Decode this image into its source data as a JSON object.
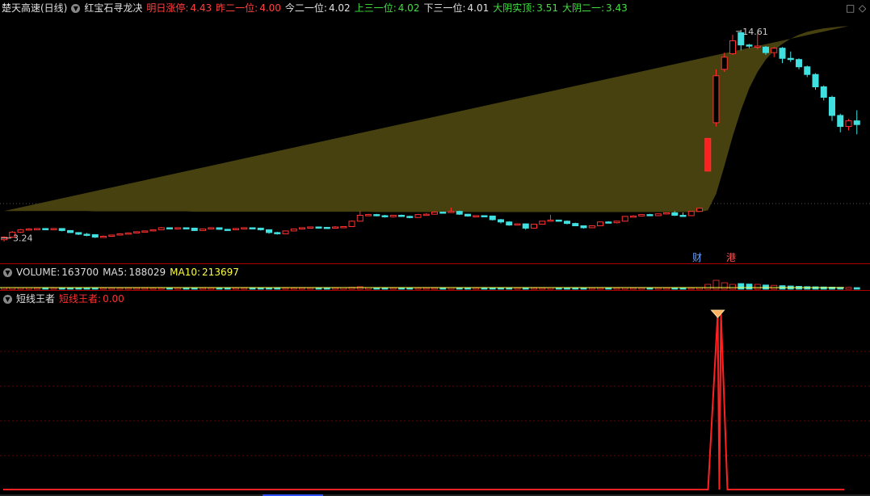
{
  "main": {
    "stock_name": "楚天高速(日线)",
    "formula_name": "红宝石寻龙决",
    "indicators": [
      {
        "label": "明日涨停:",
        "value": "4.43",
        "color": "#ff4040"
      },
      {
        "label": "昨二一位:",
        "value": "4.00",
        "color": "#ff4040"
      },
      {
        "label": "今二一位:",
        "value": "4.02",
        "color": "#e0e0e0"
      },
      {
        "label": "上三一位:",
        "value": "4.02",
        "color": "#40e040"
      },
      {
        "label": "下三一位:",
        "value": "4.01",
        "color": "#e0e0e0"
      },
      {
        "label": "大阴实顶:",
        "value": "3.51",
        "color": "#40e040"
      },
      {
        "label": "大阴二一:",
        "value": "3.43",
        "color": "#40e040"
      }
    ],
    "high_label": "14.61",
    "low_label": "3.24",
    "marker_cai": "财",
    "marker_gang": "港"
  },
  "volume": {
    "label": "VOLUME:",
    "value": "163700",
    "ma5_label": "MA5:",
    "ma5_value": "188029",
    "ma10_label": "MA10:",
    "ma10_value": "213697"
  },
  "indicator_panel": {
    "name": "短线王者",
    "line_label": "短线王者:",
    "line_value": "0.00"
  },
  "window": {
    "restore_icon": "□",
    "diamond_icon": "◇"
  },
  "chart_data": [
    {
      "type": "candlestick",
      "title": "红宝石寻龙决",
      "candles": [
        [
          3.24,
          3.3,
          3.2,
          3.32
        ],
        [
          3.3,
          3.42,
          3.28,
          3.45
        ],
        [
          3.42,
          3.48,
          3.4,
          3.5
        ],
        [
          3.48,
          3.5,
          3.46,
          3.52
        ],
        [
          3.5,
          3.51,
          3.49,
          3.52
        ],
        [
          3.51,
          3.5,
          3.49,
          3.52
        ],
        [
          3.5,
          3.51,
          3.49,
          3.52
        ],
        [
          3.51,
          3.46,
          3.44,
          3.52
        ],
        [
          3.46,
          3.41,
          3.4,
          3.47
        ],
        [
          3.41,
          3.37,
          3.35,
          3.42
        ],
        [
          3.37,
          3.36,
          3.32,
          3.4
        ],
        [
          3.36,
          3.3,
          3.28,
          3.37
        ],
        [
          3.3,
          3.32,
          3.29,
          3.34
        ],
        [
          3.32,
          3.35,
          3.31,
          3.36
        ],
        [
          3.35,
          3.38,
          3.34,
          3.39
        ],
        [
          3.38,
          3.4,
          3.37,
          3.41
        ],
        [
          3.4,
          3.43,
          3.39,
          3.44
        ],
        [
          3.43,
          3.45,
          3.42,
          3.46
        ],
        [
          3.45,
          3.48,
          3.44,
          3.49
        ],
        [
          3.48,
          3.53,
          3.47,
          3.55
        ],
        [
          3.53,
          3.5,
          3.49,
          3.54
        ],
        [
          3.5,
          3.53,
          3.49,
          3.54
        ],
        [
          3.53,
          3.52,
          3.51,
          3.54
        ],
        [
          3.52,
          3.46,
          3.45,
          3.53
        ],
        [
          3.46,
          3.5,
          3.45,
          3.51
        ],
        [
          3.5,
          3.53,
          3.49,
          3.54
        ],
        [
          3.53,
          3.49,
          3.48,
          3.54
        ],
        [
          3.49,
          3.48,
          3.47,
          3.5
        ],
        [
          3.48,
          3.51,
          3.47,
          3.52
        ],
        [
          3.51,
          3.53,
          3.5,
          3.54
        ],
        [
          3.53,
          3.52,
          3.51,
          3.54
        ],
        [
          3.52,
          3.48,
          3.46,
          3.53
        ],
        [
          3.48,
          3.41,
          3.38,
          3.49
        ],
        [
          3.41,
          3.38,
          3.36,
          3.43
        ],
        [
          3.38,
          3.45,
          3.37,
          3.46
        ],
        [
          3.45,
          3.5,
          3.44,
          3.51
        ],
        [
          3.5,
          3.53,
          3.49,
          3.54
        ],
        [
          3.53,
          3.55,
          3.52,
          3.56
        ],
        [
          3.55,
          3.54,
          3.53,
          3.56
        ],
        [
          3.54,
          3.52,
          3.51,
          3.55
        ],
        [
          3.52,
          3.55,
          3.51,
          3.57
        ],
        [
          3.55,
          3.56,
          3.54,
          3.57
        ],
        [
          3.56,
          3.7,
          3.55,
          3.72
        ],
        [
          3.7,
          3.86,
          3.69,
          3.98
        ],
        [
          3.86,
          3.88,
          3.84,
          3.9
        ],
        [
          3.88,
          3.85,
          3.83,
          3.9
        ],
        [
          3.85,
          3.82,
          3.8,
          3.87
        ],
        [
          3.82,
          3.86,
          3.8,
          3.87
        ],
        [
          3.86,
          3.83,
          3.82,
          3.88
        ],
        [
          3.83,
          3.8,
          3.78,
          3.85
        ],
        [
          3.8,
          3.88,
          3.79,
          3.9
        ],
        [
          3.88,
          3.89,
          3.87,
          3.92
        ],
        [
          3.89,
          3.95,
          3.88,
          3.97
        ],
        [
          3.95,
          3.94,
          3.93,
          3.96
        ],
        [
          3.94,
          3.97,
          3.93,
          4.08
        ],
        [
          3.97,
          3.89,
          3.87,
          3.99
        ],
        [
          3.89,
          3.84,
          3.82,
          3.9
        ],
        [
          3.84,
          3.85,
          3.83,
          3.86
        ],
        [
          3.85,
          3.84,
          3.83,
          3.86
        ],
        [
          3.84,
          3.74,
          3.72,
          3.85
        ],
        [
          3.74,
          3.68,
          3.64,
          3.76
        ],
        [
          3.68,
          3.6,
          3.58,
          3.7
        ],
        [
          3.6,
          3.63,
          3.59,
          3.64
        ],
        [
          3.63,
          3.52,
          3.48,
          3.64
        ],
        [
          3.52,
          3.62,
          3.51,
          3.63
        ],
        [
          3.62,
          3.7,
          3.61,
          3.71
        ],
        [
          3.7,
          3.73,
          3.69,
          3.87
        ],
        [
          3.73,
          3.7,
          3.69,
          3.74
        ],
        [
          3.7,
          3.64,
          3.62,
          3.72
        ],
        [
          3.64,
          3.58,
          3.57,
          3.66
        ],
        [
          3.58,
          3.53,
          3.51,
          3.59
        ],
        [
          3.53,
          3.58,
          3.52,
          3.59
        ],
        [
          3.58,
          3.68,
          3.57,
          3.69
        ],
        [
          3.68,
          3.66,
          3.65,
          3.7
        ],
        [
          3.66,
          3.7,
          3.64,
          3.71
        ],
        [
          3.7,
          3.83,
          3.69,
          3.84
        ],
        [
          3.83,
          3.84,
          3.82,
          3.86
        ],
        [
          3.84,
          3.88,
          3.83,
          3.89
        ],
        [
          3.88,
          3.85,
          3.84,
          3.9
        ],
        [
          3.85,
          3.9,
          3.84,
          3.91
        ],
        [
          3.9,
          3.93,
          3.89,
          3.94
        ],
        [
          3.93,
          3.86,
          3.84,
          3.98
        ],
        [
          3.86,
          3.85,
          3.84,
          3.94
        ],
        [
          3.85,
          3.97,
          3.84,
          3.98
        ],
        [
          3.97,
          4.06,
          3.96,
          4.07
        ],
        [
          5.3,
          6.7,
          5.3,
          6.7
        ],
        [
          7.5,
          10.5,
          7.3,
          11.0
        ],
        [
          11.0,
          12.0,
          10.8,
          12.4
        ],
        [
          12.3,
          13.5,
          12.2,
          14.1
        ],
        [
          14.3,
          13.1,
          12.6,
          14.61
        ],
        [
          13.1,
          13.0,
          12.8,
          13.2
        ],
        [
          13.0,
          13.0,
          12.7,
          14.4
        ],
        [
          12.9,
          12.4,
          12.2,
          13.0
        ],
        [
          12.4,
          12.8,
          12.0,
          12.9
        ],
        [
          12.8,
          11.9,
          11.5,
          12.9
        ],
        [
          11.9,
          11.8,
          11.6,
          12.5
        ],
        [
          11.8,
          11.2,
          11.0,
          11.9
        ],
        [
          11.2,
          10.6,
          10.4,
          11.3
        ],
        [
          10.6,
          9.7,
          9.5,
          10.7
        ],
        [
          9.7,
          9.0,
          8.8,
          9.8
        ],
        [
          9.0,
          7.9,
          7.6,
          9.1
        ],
        [
          7.9,
          7.3,
          7.0,
          8.0
        ],
        [
          7.3,
          7.6,
          7.1,
          7.7
        ],
        [
          7.6,
          7.4,
          6.9,
          8.2
        ]
      ],
      "high": 14.61,
      "low": 3.24,
      "channel_upper": [
        3.98,
        3.98,
        3.98,
        3.98,
        3.98,
        3.98,
        3.98,
        3.98,
        3.98,
        3.98,
        3.98,
        3.97,
        3.97,
        3.97,
        3.97,
        3.97,
        3.97,
        3.97,
        3.97,
        3.97,
        3.97,
        3.97,
        3.97,
        3.96,
        3.96,
        3.96,
        3.96,
        3.96,
        3.96,
        3.96,
        3.96,
        3.96,
        3.96,
        3.96,
        3.96,
        3.96,
        3.96,
        3.96,
        3.96,
        3.96,
        3.96,
        3.96,
        3.96,
        3.96,
        3.96,
        3.95,
        3.95,
        3.95,
        3.95,
        3.95,
        3.95,
        3.95,
        3.95,
        3.95,
        3.95,
        3.95,
        3.95,
        3.95,
        3.95,
        3.95,
        3.95,
        3.95,
        3.95,
        3.95,
        3.95,
        3.95,
        3.95,
        3.95,
        3.95,
        3.95,
        3.95,
        3.95,
        3.95,
        3.95,
        3.95,
        3.95,
        3.95,
        3.95,
        3.95,
        3.95,
        3.95,
        3.95,
        3.95,
        3.95,
        3.95,
        4.0,
        4.5,
        5.5,
        6.8,
        8.2,
        9.6,
        10.8,
        11.8,
        12.6,
        13.2,
        13.7,
        14.1,
        14.4,
        14.6,
        14.75,
        14.85,
        14.95,
        15.0
      ],
      "channel_lower": [
        3.82,
        3.81,
        3.8,
        3.79,
        3.78,
        3.78,
        3.77,
        3.76,
        3.76,
        3.75,
        3.75,
        3.74,
        3.74,
        3.73,
        3.73,
        3.72,
        3.72,
        3.71,
        3.71,
        3.7,
        3.7,
        3.7,
        3.69,
        3.69,
        3.68,
        3.68,
        3.68,
        3.67,
        3.67,
        3.67,
        3.66,
        3.66,
        3.66,
        3.66,
        3.65,
        3.65,
        3.65,
        3.65,
        3.65,
        3.65,
        3.65,
        3.65,
        3.65,
        3.65,
        3.65,
        3.65,
        3.65,
        3.65,
        3.65,
        3.65,
        3.65,
        3.65,
        3.65,
        3.65,
        3.65,
        3.65,
        3.65,
        3.65,
        3.65,
        3.65,
        3.65,
        3.65,
        3.65,
        3.65,
        3.65,
        3.65,
        3.65,
        3.65,
        3.65,
        3.65,
        3.65,
        3.65,
        3.65,
        3.65,
        3.65,
        3.65,
        3.65,
        3.66,
        3.66,
        3.67,
        3.68,
        3.7,
        3.72,
        3.75,
        3.8,
        3.9,
        4.2,
        4.8,
        5.6,
        6.5,
        7.5,
        8.4,
        9.2,
        9.9,
        10.5,
        11.0,
        11.4,
        11.7,
        11.95,
        12.15,
        12.3,
        12.4,
        12.5
      ]
    },
    {
      "type": "bar",
      "title": "VOLUME",
      "values": [
        10,
        10,
        9,
        9,
        8,
        8,
        8,
        8,
        9,
        8,
        8,
        8,
        8,
        8,
        8,
        8,
        8,
        8,
        8,
        8,
        8,
        8,
        8,
        8,
        8,
        8,
        9,
        8,
        8,
        8,
        8,
        8,
        8,
        8,
        8,
        8,
        8,
        8,
        8,
        8,
        8,
        9,
        12,
        15,
        10,
        9,
        8,
        8,
        8,
        8,
        8,
        8,
        8,
        8,
        9,
        9,
        8,
        8,
        8,
        8,
        9,
        9,
        8,
        8,
        8,
        8,
        9,
        8,
        8,
        8,
        8,
        8,
        8,
        8,
        8,
        9,
        8,
        8,
        8,
        8,
        8,
        9,
        8,
        8,
        9,
        30,
        55,
        40,
        30,
        35,
        32,
        30,
        26,
        24,
        22,
        20,
        18,
        16,
        15,
        14,
        13,
        12,
        11,
        10
      ]
    },
    {
      "type": "line",
      "title": "短线王者",
      "signal_index": 86,
      "values_note": ""
    }
  ]
}
